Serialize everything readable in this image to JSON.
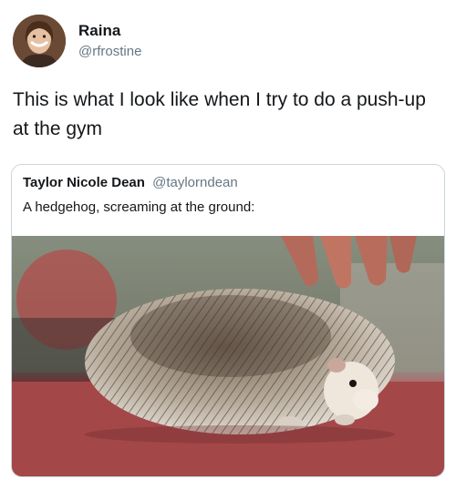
{
  "tweet": {
    "author": {
      "name": "Raina",
      "handle": "@rfrostine",
      "avatar_icon": "profile-photo"
    },
    "text": "This is what I look like when I try to do a push-up at the gym"
  },
  "quoted_tweet": {
    "author": {
      "name": "Taylor Nicole Dean",
      "handle": "@taylorndean"
    },
    "text": "A hedgehog, screaming at the ground:",
    "media_icon": "hedgehog-photo"
  },
  "colors": {
    "text_primary": "#14171a",
    "text_secondary": "#657786",
    "border": "#ccd6dd",
    "ground": "#a6464a"
  }
}
